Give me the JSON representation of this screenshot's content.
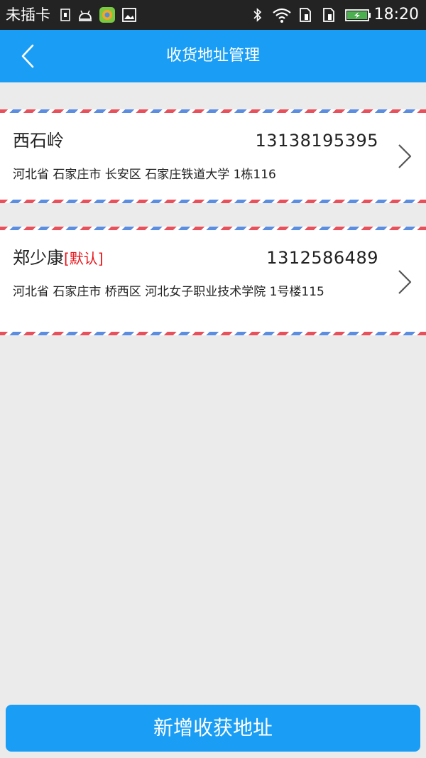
{
  "status_bar": {
    "carrier": "未插卡",
    "time": "18:20",
    "icons": [
      "sim-icon",
      "android-icon",
      "app-icon",
      "image-icon",
      "bluetooth-icon",
      "wifi-icon",
      "sim-slot-icon",
      "sim-slot-icon",
      "battery-charging-icon"
    ]
  },
  "header": {
    "title": "收货地址管理",
    "back_icon": "chevron-left-icon"
  },
  "addresses": [
    {
      "name": "西石岭",
      "default_tag": "",
      "phone": "13138195395",
      "address": "河北省 石家庄市 长安区 石家庄铁道大学  1栋116"
    },
    {
      "name": "郑少康",
      "default_tag": "[默认]",
      "phone": "1312586489",
      "address": "河北省 石家庄市 桥西区 河北女子职业技术学院   1号楼115"
    }
  ],
  "footer": {
    "add_button_label": "新增收获地址"
  },
  "colors": {
    "primary": "#1a9ef5",
    "default_tag": "#e8141b",
    "stripe_red": "#e8505b",
    "stripe_blue": "#5b8de0",
    "background": "#ebebeb"
  }
}
